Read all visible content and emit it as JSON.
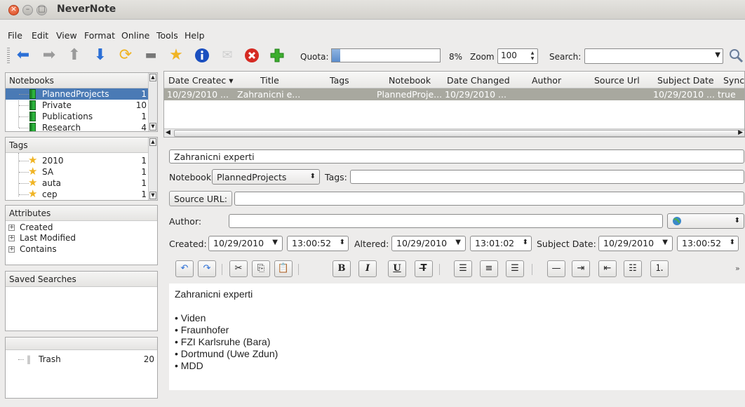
{
  "window": {
    "title": "NeverNote"
  },
  "menu": [
    "File",
    "Edit",
    "View",
    "Format",
    "Online",
    "Tools",
    "Help"
  ],
  "toolbar": {
    "quota_label": "Quota:",
    "quota_percent": 8,
    "quota_text": "8%",
    "zoom_label": "Zoom",
    "zoom_value": "100",
    "search_label": "Search:",
    "search_value": ""
  },
  "notebooks": {
    "header": "Notebooks",
    "items": [
      {
        "name": "PlannedProjects",
        "count": "1",
        "selected": true
      },
      {
        "name": "Private",
        "count": "10"
      },
      {
        "name": "Publications",
        "count": "1"
      },
      {
        "name": "Research",
        "count": "4"
      }
    ]
  },
  "tags": {
    "header": "Tags",
    "items": [
      {
        "name": "2010",
        "count": "1"
      },
      {
        "name": "SA",
        "count": "1"
      },
      {
        "name": "auta",
        "count": "1"
      },
      {
        "name": "cep",
        "count": "1"
      }
    ]
  },
  "attributes": {
    "header": "Attributes",
    "items": [
      "Created",
      "Last Modified",
      "Contains"
    ]
  },
  "saved_searches": {
    "header": "Saved Searches"
  },
  "trash": {
    "label": "Trash",
    "count": "20"
  },
  "note_list": {
    "columns": [
      "Date Createc",
      "Title",
      "Tags",
      "Notebook",
      "Date Changed",
      "Author",
      "Source Url",
      "Subject Date",
      "Sync"
    ],
    "rows": [
      [
        "10/29/2010 ...",
        "Zahranicni e...",
        "",
        "PlannedProje...",
        "10/29/2010 ...",
        "",
        "",
        "10/29/2010 ...",
        "true"
      ]
    ]
  },
  "editor": {
    "title": "Zahranicni experti",
    "notebook_label": "Notebook",
    "notebook_value": "PlannedProjects",
    "tags_label": "Tags:",
    "source_url_label": "Source URL:",
    "source_url_value": "",
    "author_label": "Author:",
    "author_value": "",
    "created_label": "Created:",
    "created_date": "10/29/2010",
    "created_time": "13:00:52",
    "altered_label": "Altered:",
    "altered_date": "10/29/2010",
    "altered_time": "13:01:02",
    "subject_label": "Subject Date:",
    "subject_date": "10/29/2010",
    "subject_time": "13:00:52",
    "body_title": "Zahranicni experti",
    "bullets": [
      "Viden",
      "Fraunhofer",
      "FZI Karlsruhe (Bara)",
      "Dortmund (Uwe Zdun)",
      "MDD"
    ]
  },
  "colors": {
    "selection": "#4a7ab5",
    "row_highlight": "#a8a89f",
    "accent_blue": "#2b6fd6"
  }
}
